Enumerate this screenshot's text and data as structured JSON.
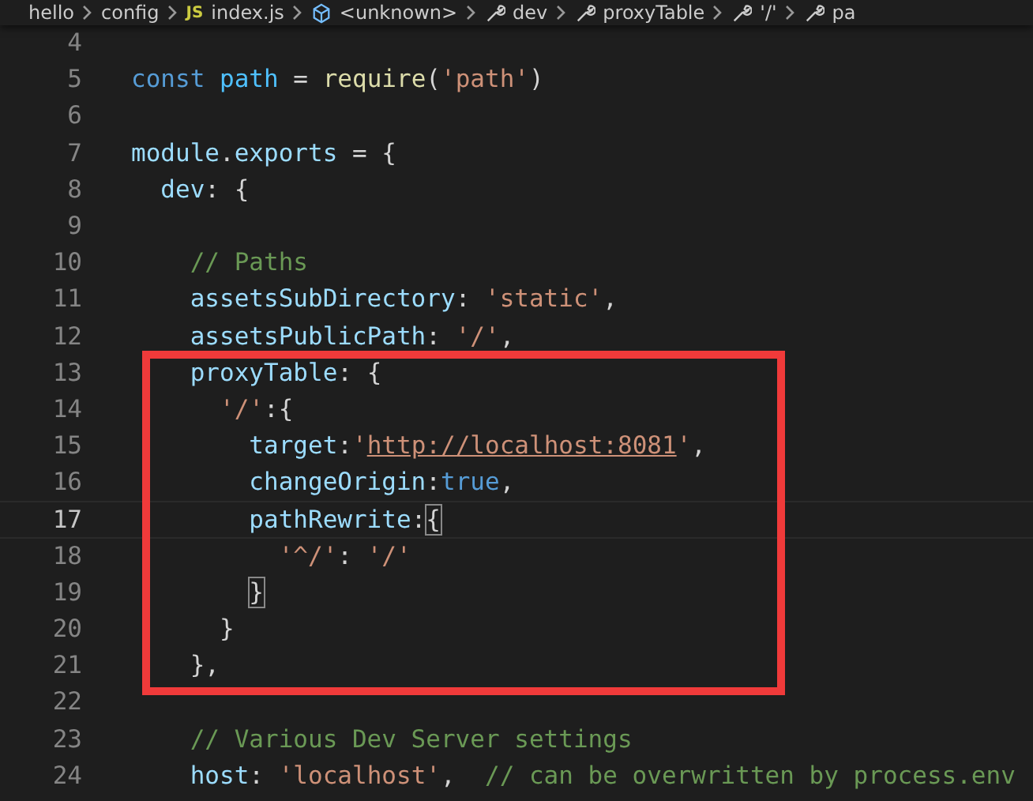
{
  "breadcrumb": [
    {
      "label": "hello",
      "kind": "folder"
    },
    {
      "label": "config",
      "kind": "folder"
    },
    {
      "label": "index.js",
      "kind": "file",
      "badge": "JS"
    },
    {
      "label": "<unknown>",
      "kind": "symbol"
    },
    {
      "label": "dev",
      "kind": "property"
    },
    {
      "label": "proxyTable",
      "kind": "property"
    },
    {
      "label": "'/'",
      "kind": "property"
    },
    {
      "label": "pa",
      "kind": "property"
    }
  ],
  "lines": [
    {
      "number": "4",
      "current": false
    },
    {
      "number": "5",
      "current": false,
      "tokens": [
        {
          "text": "const ",
          "kind": "keyword"
        },
        {
          "text": "path",
          "kind": "constant"
        },
        {
          "text": " = ",
          "kind": "punct"
        },
        {
          "text": "require",
          "kind": "function"
        },
        {
          "text": "(",
          "kind": "punct"
        },
        {
          "text": "'path'",
          "kind": "string"
        },
        {
          "text": ")",
          "kind": "punct"
        }
      ]
    },
    {
      "number": "6",
      "current": false
    },
    {
      "number": "7",
      "current": false,
      "tokens": [
        {
          "text": "module",
          "kind": "variable"
        },
        {
          "text": ".",
          "kind": "punct"
        },
        {
          "text": "exports",
          "kind": "variable"
        },
        {
          "text": " = {",
          "kind": "punct"
        }
      ]
    },
    {
      "number": "8",
      "current": false,
      "tokens": [
        {
          "text": "  dev",
          "kind": "variable"
        },
        {
          "text": ": {",
          "kind": "punct"
        }
      ]
    },
    {
      "number": "9",
      "current": false
    },
    {
      "number": "10",
      "current": false,
      "tokens": [
        {
          "text": "    // Paths",
          "kind": "comment"
        }
      ]
    },
    {
      "number": "11",
      "current": false,
      "tokens": [
        {
          "text": "    assetsSubDirectory",
          "kind": "variable"
        },
        {
          "text": ": ",
          "kind": "punct"
        },
        {
          "text": "'static'",
          "kind": "string"
        },
        {
          "text": ",",
          "kind": "punct"
        }
      ]
    },
    {
      "number": "12",
      "current": false,
      "tokens": [
        {
          "text": "    assetsPublicPath",
          "kind": "variable"
        },
        {
          "text": ": ",
          "kind": "punct"
        },
        {
          "text": "'/'",
          "kind": "string"
        },
        {
          "text": ",",
          "kind": "punct"
        }
      ]
    },
    {
      "number": "13",
      "current": false,
      "tokens": [
        {
          "text": "    proxyTable",
          "kind": "variable"
        },
        {
          "text": ": {",
          "kind": "punct"
        }
      ]
    },
    {
      "number": "14",
      "current": false,
      "tokens": [
        {
          "text": "      '/'",
          "kind": "string"
        },
        {
          "text": ":{",
          "kind": "punct"
        }
      ]
    },
    {
      "number": "15",
      "current": false,
      "tokens": [
        {
          "text": "        target",
          "kind": "variable"
        },
        {
          "text": ":",
          "kind": "punct"
        },
        {
          "text": "'",
          "kind": "string"
        },
        {
          "text": "http://localhost:8081",
          "kind": "link"
        },
        {
          "text": "'",
          "kind": "string"
        },
        {
          "text": ",",
          "kind": "punct"
        }
      ]
    },
    {
      "number": "16",
      "current": false,
      "tokens": [
        {
          "text": "        changeOrigin",
          "kind": "variable"
        },
        {
          "text": ":",
          "kind": "punct"
        },
        {
          "text": "true",
          "kind": "keyword"
        },
        {
          "text": ",",
          "kind": "punct"
        }
      ]
    },
    {
      "number": "17",
      "current": true,
      "tokens": [
        {
          "text": "        pathRewrite",
          "kind": "variable"
        },
        {
          "text": ":",
          "kind": "punct"
        },
        {
          "text": "{",
          "kind": "bracket"
        }
      ]
    },
    {
      "number": "18",
      "current": false,
      "tokens": [
        {
          "text": "          '^/'",
          "kind": "string"
        },
        {
          "text": ": ",
          "kind": "punct"
        },
        {
          "text": "'/'",
          "kind": "string"
        }
      ]
    },
    {
      "number": "19",
      "current": false,
      "tokens": [
        {
          "text": "        }",
          "kind": "bracket"
        }
      ]
    },
    {
      "number": "20",
      "current": false,
      "tokens": [
        {
          "text": "      }",
          "kind": "punct"
        }
      ]
    },
    {
      "number": "21",
      "current": false,
      "tokens": [
        {
          "text": "    },",
          "kind": "punct"
        }
      ]
    },
    {
      "number": "22",
      "current": false
    },
    {
      "number": "23",
      "current": false,
      "tokens": [
        {
          "text": "    // Various Dev Server settings",
          "kind": "comment"
        }
      ]
    },
    {
      "number": "24",
      "current": false,
      "tokens": [
        {
          "text": "    host",
          "kind": "variable"
        },
        {
          "text": ": ",
          "kind": "punct"
        },
        {
          "text": "'localhost'",
          "kind": "string"
        },
        {
          "text": ",  ",
          "kind": "punct"
        },
        {
          "text": "// can be overwritten by process.env",
          "kind": "comment"
        }
      ]
    }
  ]
}
